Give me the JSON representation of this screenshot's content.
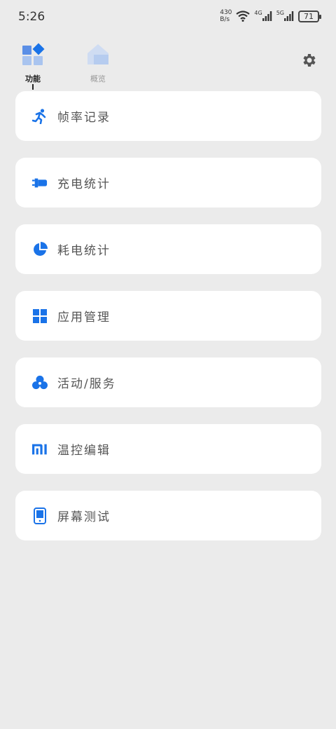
{
  "status": {
    "time": "5:26",
    "net_speed_value": "430",
    "net_speed_unit": "B/s",
    "signal1_label": "4G",
    "signal2_label": "5G",
    "battery": "71"
  },
  "tabs": [
    {
      "label": "功能",
      "icon": "functions-icon",
      "active": true
    },
    {
      "label": "概览",
      "icon": "overview-home-icon",
      "active": false
    }
  ],
  "menu": [
    {
      "label": "帧率记录",
      "icon": "running-icon"
    },
    {
      "label": "充电统计",
      "icon": "charger-plug-icon"
    },
    {
      "label": "耗电统计",
      "icon": "pie-chart-icon"
    },
    {
      "label": "应用管理",
      "icon": "apps-grid-icon"
    },
    {
      "label": "活动/服务",
      "icon": "circles-icon"
    },
    {
      "label": "温控编辑",
      "icon": "mi-logo-icon"
    },
    {
      "label": "屏幕测试",
      "icon": "phone-screen-icon"
    }
  ],
  "colors": {
    "accent": "#1a73e8",
    "background": "#ebebeb",
    "card": "#ffffff"
  }
}
